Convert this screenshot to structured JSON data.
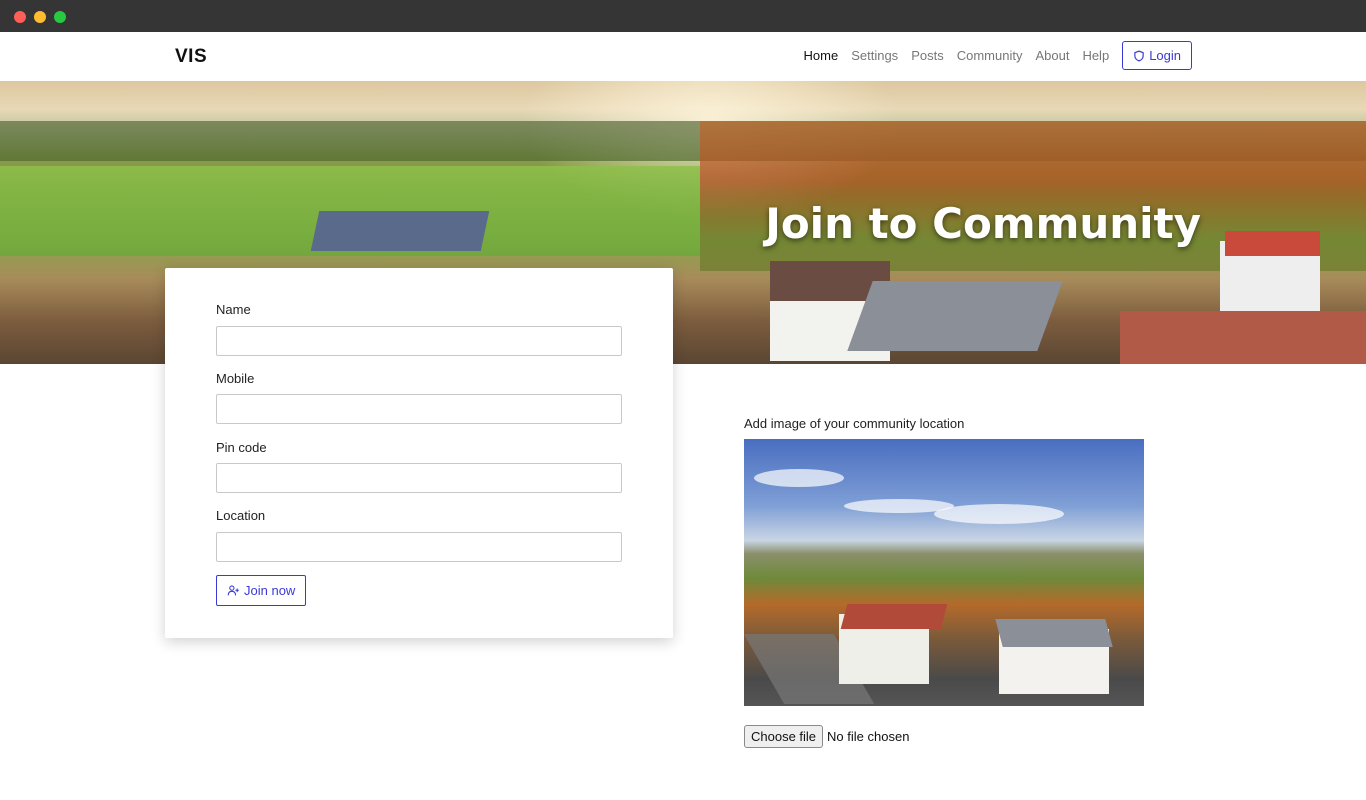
{
  "navbar": {
    "brand": "VIS",
    "items": [
      {
        "label": "Home",
        "active": true
      },
      {
        "label": "Settings",
        "active": false
      },
      {
        "label": "Posts",
        "active": false
      },
      {
        "label": "Community",
        "active": false
      },
      {
        "label": "About",
        "active": false
      },
      {
        "label": "Help",
        "active": false
      }
    ],
    "login_label": "Login",
    "login_icon": "shield-icon"
  },
  "hero": {
    "title": "Join to Community"
  },
  "form": {
    "fields": [
      {
        "label": "Name",
        "value": ""
      },
      {
        "label": "Mobile",
        "value": ""
      },
      {
        "label": "Pin code",
        "value": ""
      },
      {
        "label": "Location",
        "value": ""
      }
    ],
    "submit_label": "Join now",
    "submit_icon": "user-plus-icon"
  },
  "upload": {
    "label": "Add image of your community location",
    "button_label": "Choose file",
    "status": "No file chosen"
  },
  "colors": {
    "accent": "#3a3ad6"
  }
}
